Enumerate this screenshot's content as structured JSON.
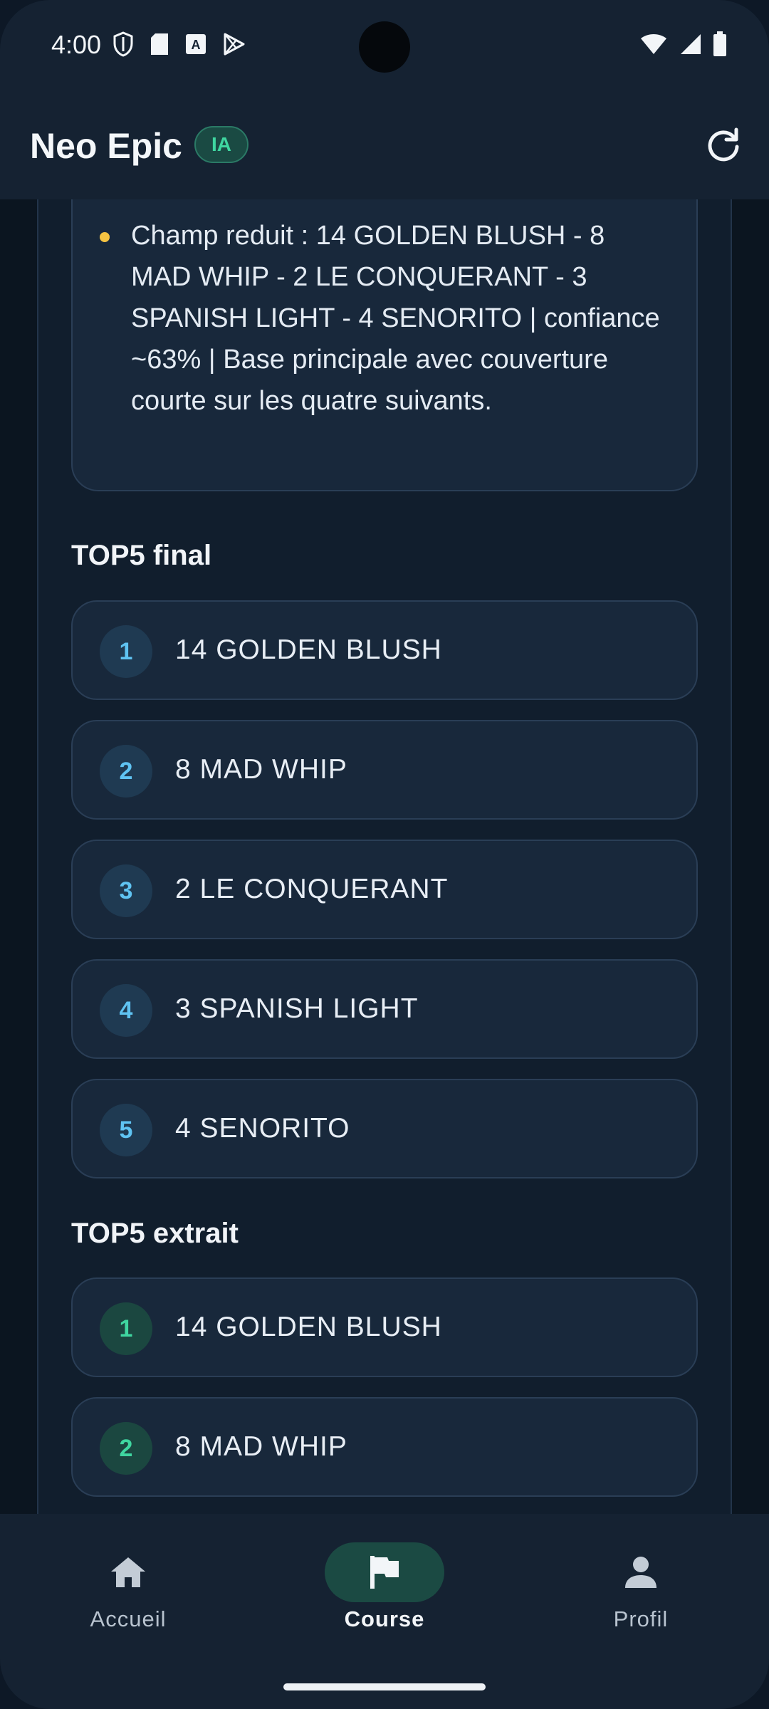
{
  "status_bar": {
    "time": "4:00"
  },
  "app_bar": {
    "title": "Neo Epic",
    "badge": "IA"
  },
  "note": {
    "text": "Champ reduit : 14 GOLDEN BLUSH - 8 MAD WHIP - 2 LE CONQUERANT - 3 SPANISH LIGHT - 4 SENORITO | confiance ~63% | Base principale avec couverture courte sur les quatre suivants."
  },
  "top5_final": {
    "title": "TOP5 final",
    "items": [
      {
        "rank": "1",
        "label": "14 GOLDEN BLUSH"
      },
      {
        "rank": "2",
        "label": "8 MAD WHIP"
      },
      {
        "rank": "3",
        "label": "2 LE CONQUERANT"
      },
      {
        "rank": "4",
        "label": "3 SPANISH LIGHT"
      },
      {
        "rank": "5",
        "label": "4 SENORITO"
      }
    ]
  },
  "top5_extrait": {
    "title": "TOP5 extrait",
    "items": [
      {
        "rank": "1",
        "label": "14 GOLDEN BLUSH"
      },
      {
        "rank": "2",
        "label": "8 MAD WHIP"
      }
    ]
  },
  "bottom_nav": {
    "items": [
      {
        "label": "Accueil",
        "icon": "home-icon"
      },
      {
        "label": "Course",
        "icon": "flag-icon",
        "active": true
      },
      {
        "label": "Profil",
        "icon": "person-icon"
      }
    ]
  },
  "colors": {
    "accent_green": "#3fd6a0",
    "accent_blue": "#5fc3f2",
    "bullet_yellow": "#f5c342",
    "background": "#0e1a28"
  }
}
